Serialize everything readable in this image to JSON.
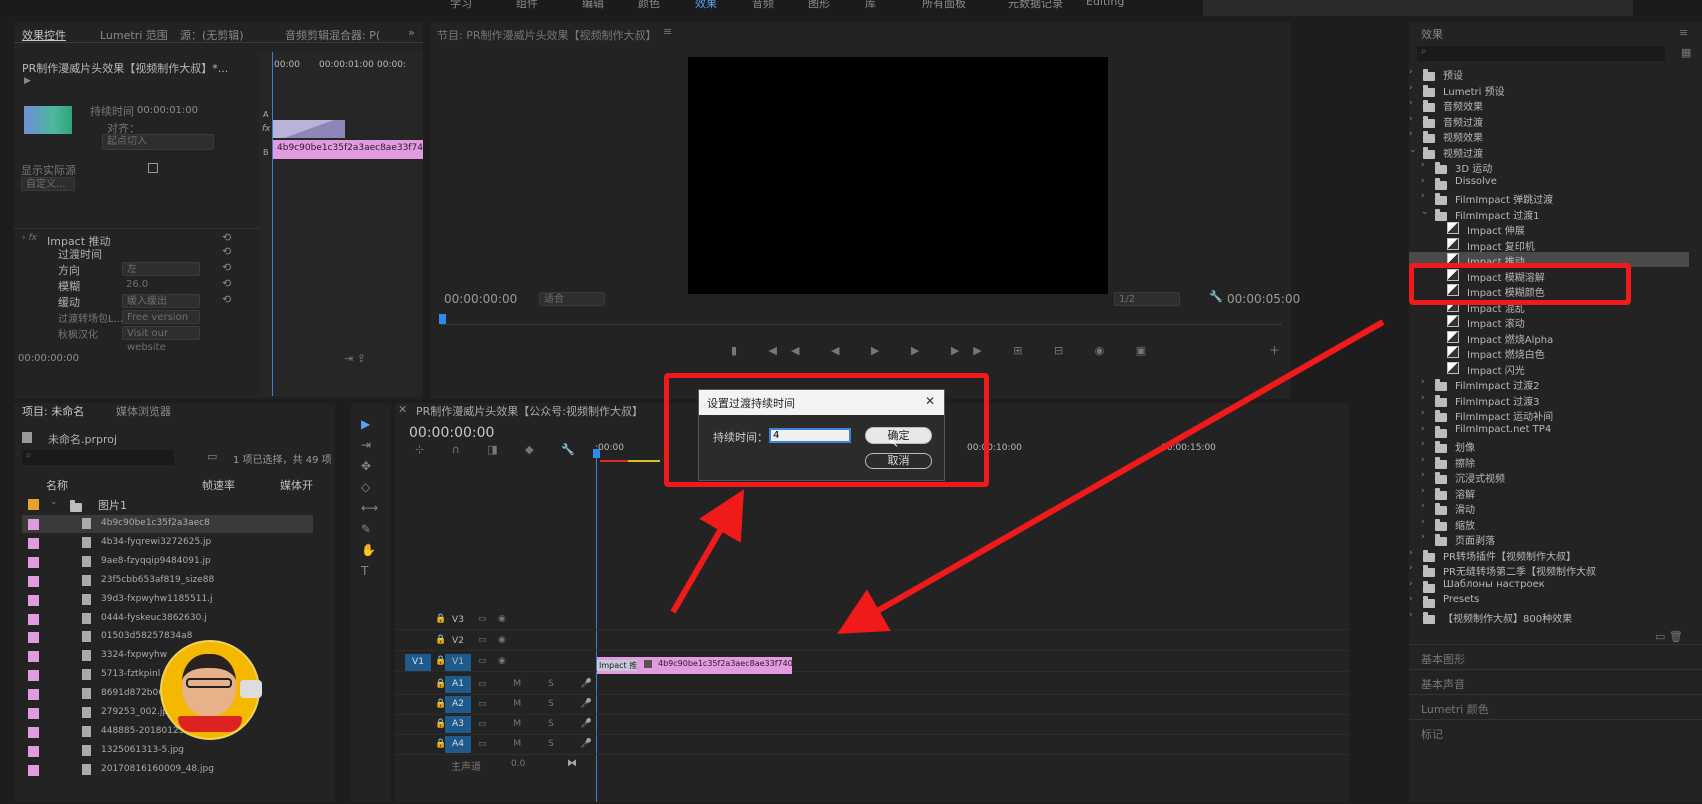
{
  "workspace_tabs": [
    "学习",
    "组件",
    "编辑",
    "颜色",
    "效果",
    "音频",
    "图形",
    "库",
    "所有面板",
    "元数据记录",
    "Editing"
  ],
  "workspace_active": "效果",
  "effect_controls": {
    "tabs": [
      "效果控件",
      "Lumetri 范围",
      "源：(无剪辑)",
      "音频剪辑混合器: P("
    ],
    "sequence": "PR制作漫威片头效果【视频制作大叔】*...",
    "ruler": [
      "00:00",
      "00:00:01:00",
      "00:00:"
    ],
    "clip_label": "4b9c90be1c35f2a3aec8ae33f740c18",
    "duration_label": "持续时间",
    "duration_value": "00:00:01:00",
    "align_label": "对齐：",
    "align_value": "起点切入",
    "show_actual": "显示实际源",
    "customize": "自定义...",
    "fx_name": "Impact 推动",
    "props": [
      {
        "label": "过渡时间",
        "value": ""
      },
      {
        "label": "方向",
        "value": "左"
      },
      {
        "label": "模糊",
        "value": "26.0"
      },
      {
        "label": "缓动",
        "value": "缓入缓出"
      },
      {
        "label": "过渡转场包L...",
        "value": "Free version"
      },
      {
        "label": "秋枫汉化",
        "value": "Visit our website"
      }
    ],
    "timecode": "00:00:00:00"
  },
  "program": {
    "title": "节目: PR制作漫威片头效果【视频制作大叔】",
    "timecode_left": "00:00:00:00",
    "fit": "适合",
    "quality": "1/2",
    "timecode_right": "00:00:05:00"
  },
  "project": {
    "tabs": [
      "项目: 未命名",
      "媒体浏览器"
    ],
    "file": "未命名.prproj",
    "selection": "1 项已选择，共 49 项",
    "columns": [
      "名称",
      "帧速率",
      "媒体开"
    ],
    "folder": "图片1",
    "items": [
      "4b9c90be1c35f2a3aec8",
      "4b34-fyqrewi3272625.jp",
      "9ae8-fzyqqip9484091.jp",
      "23f5cbb653af819_size88",
      "39d3-fxpwyhw1185511.j",
      "0444-fyskeuc3862630.j",
      "01503d58257834a8",
      "3324-fxpwyhw",
      "5713-fztkpinl",
      "8691d872b06",
      "279253_002.jpg",
      "448885-20180125181025",
      "1325061313-5.jpg",
      "20170816160009_48.jpg"
    ]
  },
  "timeline": {
    "title": "PR制作漫威片头效果【公众号:视频制作大叔】",
    "timecode": "00:00:00:00",
    "ruler": [
      ":00:00",
      "00:00:10:00",
      "00:00:15:00"
    ],
    "video_tracks": [
      "V3",
      "V2",
      "V1"
    ],
    "audio_tracks": [
      "A1",
      "A2",
      "A3",
      "A4"
    ],
    "source_v": "V1",
    "master": "主声道",
    "master_value": "0.0",
    "clip_label": "4b9c90be1c35f2a3aec8ae33f740c18f.jpg",
    "transition_label": "Impact 推"
  },
  "dialog": {
    "title": "设置过渡持续时间",
    "duration_label": "持续时间：",
    "duration_value": "4",
    "ok": "确定",
    "cancel": "取消",
    "close": "✕"
  },
  "effects": {
    "title": "效果",
    "tree": [
      {
        "label": "预设",
        "type": "folder",
        "level": 0,
        "open": false
      },
      {
        "label": "Lumetri 预设",
        "type": "folder",
        "level": 0,
        "open": false
      },
      {
        "label": "音频效果",
        "type": "folder",
        "level": 0,
        "open": false
      },
      {
        "label": "音频过渡",
        "type": "folder",
        "level": 0,
        "open": false
      },
      {
        "label": "视频效果",
        "type": "folder",
        "level": 0,
        "open": false
      },
      {
        "label": "视频过渡",
        "type": "folder",
        "level": 0,
        "open": true
      },
      {
        "label": "3D 运动",
        "type": "folder",
        "level": 1,
        "open": false
      },
      {
        "label": "Dissolve",
        "type": "folder",
        "level": 1,
        "open": false
      },
      {
        "label": "FilmImpact 弹跳过渡",
        "type": "folder",
        "level": 1,
        "open": false
      },
      {
        "label": "FilmImpact 过渡1",
        "type": "folder",
        "level": 1,
        "open": true
      },
      {
        "label": "Impact 伸展",
        "type": "fx",
        "level": 2
      },
      {
        "label": "Impact 复印机",
        "type": "fx",
        "level": 2
      },
      {
        "label": "Impact 推动",
        "type": "fx",
        "level": 2,
        "selected": true
      },
      {
        "label": "Impact 模糊溶解",
        "type": "fx",
        "level": 2
      },
      {
        "label": "Impact 模糊颜色",
        "type": "fx",
        "level": 2
      },
      {
        "label": "Impact 混乱",
        "type": "fx",
        "level": 2
      },
      {
        "label": "Impact 滚动",
        "type": "fx",
        "level": 2
      },
      {
        "label": "Impact 燃烧Alpha",
        "type": "fx",
        "level": 2
      },
      {
        "label": "Impact 燃烧白色",
        "type": "fx",
        "level": 2
      },
      {
        "label": "Impact 闪光",
        "type": "fx",
        "level": 2
      },
      {
        "label": "FilmImpact 过渡2",
        "type": "folder",
        "level": 1,
        "open": false
      },
      {
        "label": "FilmImpact 过渡3",
        "type": "folder",
        "level": 1,
        "open": false
      },
      {
        "label": "FilmImpact 运动补间",
        "type": "folder",
        "level": 1,
        "open": false
      },
      {
        "label": "FilmImpact.net TP4",
        "type": "folder",
        "level": 1,
        "open": false
      },
      {
        "label": "划像",
        "type": "folder",
        "level": 1,
        "open": false
      },
      {
        "label": "擦除",
        "type": "folder",
        "level": 1,
        "open": false
      },
      {
        "label": "沉浸式视频",
        "type": "folder",
        "level": 1,
        "open": false
      },
      {
        "label": "溶解",
        "type": "folder",
        "level": 1,
        "open": false
      },
      {
        "label": "滑动",
        "type": "folder",
        "level": 1,
        "open": false
      },
      {
        "label": "缩放",
        "type": "folder",
        "level": 1,
        "open": false
      },
      {
        "label": "页面剥落",
        "type": "folder",
        "level": 1,
        "open": false
      },
      {
        "label": "PR转场插件【视频制作大叔】",
        "type": "folder",
        "level": 0,
        "open": false
      },
      {
        "label": "PR无缝转场第二季【视频制作大叔",
        "type": "folder",
        "level": 0,
        "open": false
      },
      {
        "label": "Шаблоны настроек",
        "type": "folder",
        "level": 0,
        "open": false
      },
      {
        "label": "Presets",
        "type": "folder",
        "level": 0,
        "open": false
      },
      {
        "label": "【视频制作大叔】800种效果",
        "type": "folder",
        "level": 0,
        "open": false
      }
    ],
    "sections": [
      "基本图形",
      "基本声音",
      "Lumetri 颜色",
      "标记"
    ]
  },
  "colors": {
    "accent": "#2d8ceb",
    "clip": "#e39be0",
    "annotation": "#f01a1a",
    "track_blue": "#1f5a8c"
  }
}
